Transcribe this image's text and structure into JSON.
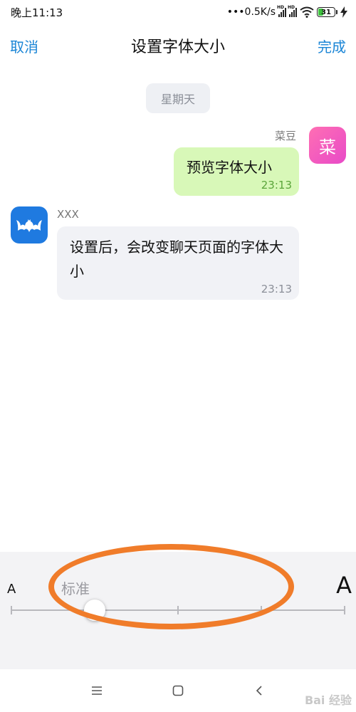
{
  "status_bar": {
    "time": "晚上11:13",
    "network_speed": "•••0.5K/s",
    "signal_tag": "HD",
    "battery_level": "31",
    "battery_percent": 31
  },
  "nav": {
    "cancel_label": "取消",
    "title": "设置字体大小",
    "done_label": "完成"
  },
  "chat": {
    "date_label": "星期天",
    "outgoing": {
      "sender": "菜豆",
      "avatar_char": "菜",
      "text": "预览字体大小",
      "time": "23:13",
      "avatar_color": "#e84ac8",
      "bubble_color": "#d8f8b8"
    },
    "incoming": {
      "sender": "XXX",
      "avatar_icon": "bat-logo-icon",
      "text": "设置后，会改变聊天页面的字体大小",
      "time": "23:13",
      "avatar_color": "#1f7ae0",
      "bubble_color": "#f1f2f6"
    }
  },
  "font_panel": {
    "small_label": "A",
    "large_label": "A",
    "current_level_label": "标准",
    "slider_steps": 5,
    "selected_step": 1
  },
  "annotation": {
    "highlight_color": "#f07c2a"
  },
  "system_nav": {
    "menu_icon": "menu-icon",
    "home_icon": "home-icon",
    "back_icon": "back-icon"
  },
  "watermark": {
    "text": "Bai 经验"
  }
}
